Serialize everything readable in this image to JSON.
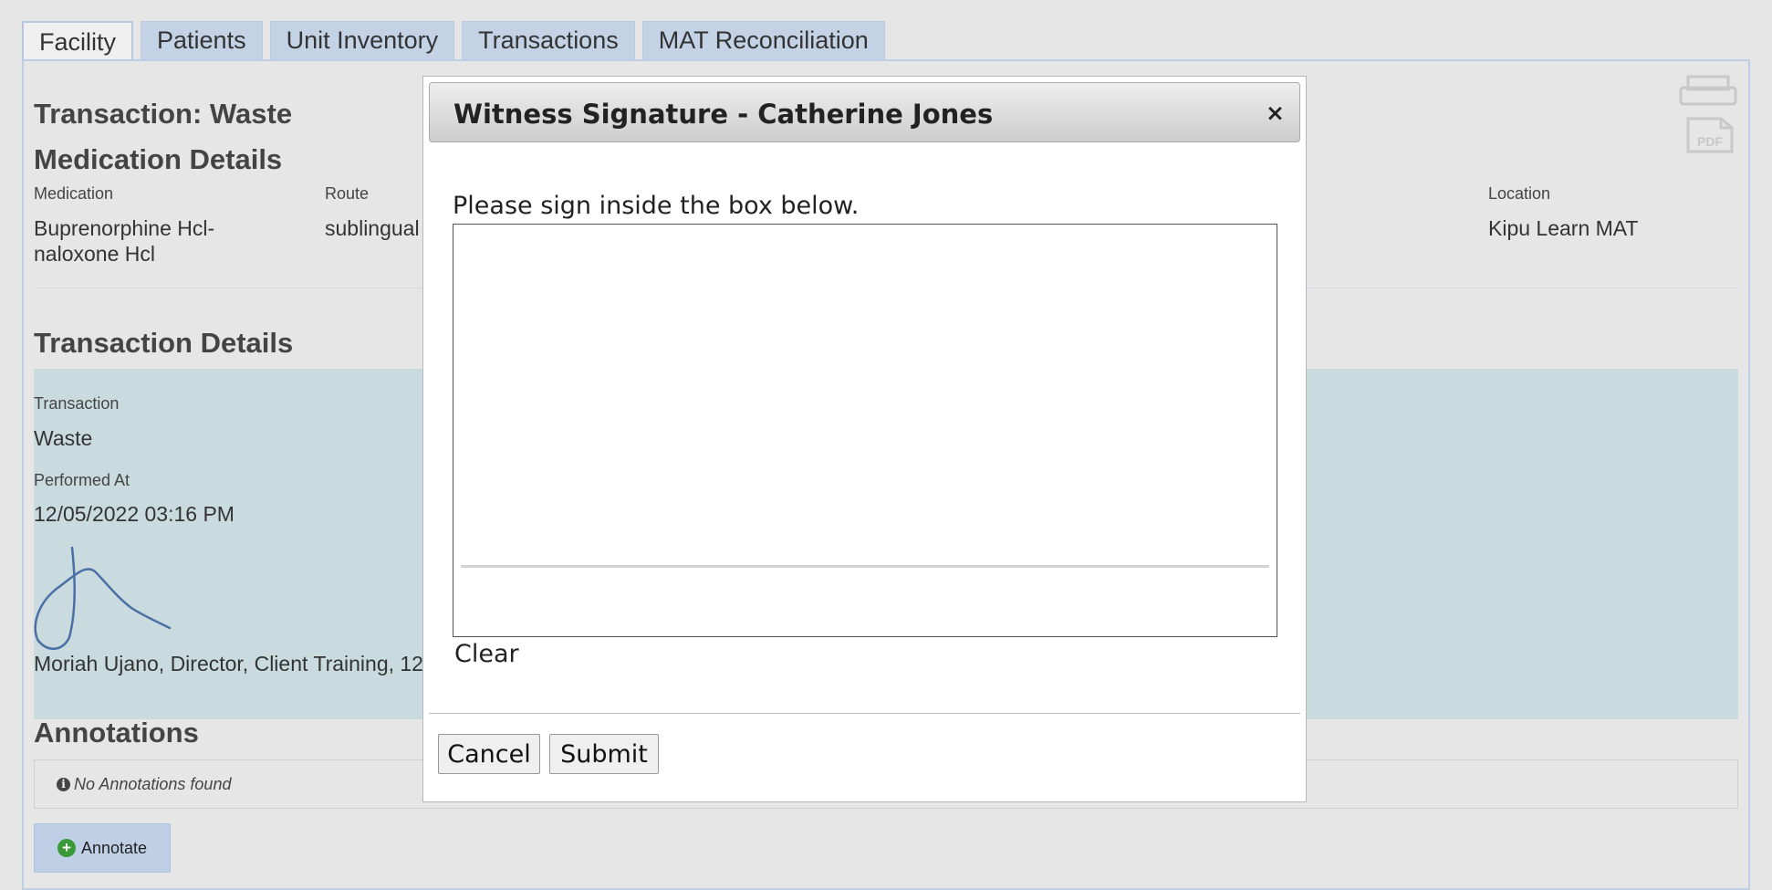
{
  "tabs": [
    "Facility",
    "Patients",
    "Unit Inventory",
    "Transactions",
    "MAT Reconciliation"
  ],
  "page": {
    "transaction_title": "Transaction: Waste",
    "medication_details_heading": "Medication Details",
    "medication": {
      "label": "Medication",
      "value_line1": "Buprenorphine Hcl-",
      "value_line2": "naloxone Hcl"
    },
    "route": {
      "label": "Route",
      "value": "sublingual"
    },
    "location": {
      "label": "Location",
      "value": "Kipu Learn MAT"
    },
    "transaction_details_heading": "Transaction Details",
    "transaction": {
      "label": "Transaction",
      "value": "Waste"
    },
    "performed_at": {
      "label": "Performed At",
      "value": "12/05/2022 03:16 PM"
    },
    "signer_text": "Moriah Ujano, Director, Client Training, 12",
    "annotations_heading": "Annotations",
    "no_annotations": "No Annotations found",
    "annotate_label": "Annotate",
    "pdf_icon_label": "PDF",
    "info_icon_glyph": "i",
    "plus_icon_glyph": "+"
  },
  "modal": {
    "title": "Witness Signature - Catherine Jones",
    "close_glyph": "×",
    "instruction": "Please sign inside the box below.",
    "clear_label": "Clear",
    "cancel_label": "Cancel",
    "submit_label": "Submit"
  },
  "icons": {
    "print": "printer-icon",
    "pdf": "pdf-icon",
    "info": "info-icon",
    "add": "plus-circle-icon",
    "close": "close-icon"
  },
  "colors": {
    "tab_bg": "#c4d2e6",
    "panel_bg": "#cadbe0",
    "signature_stroke": "#4a6fa5",
    "annotate_bg": "#bfd0e6"
  }
}
